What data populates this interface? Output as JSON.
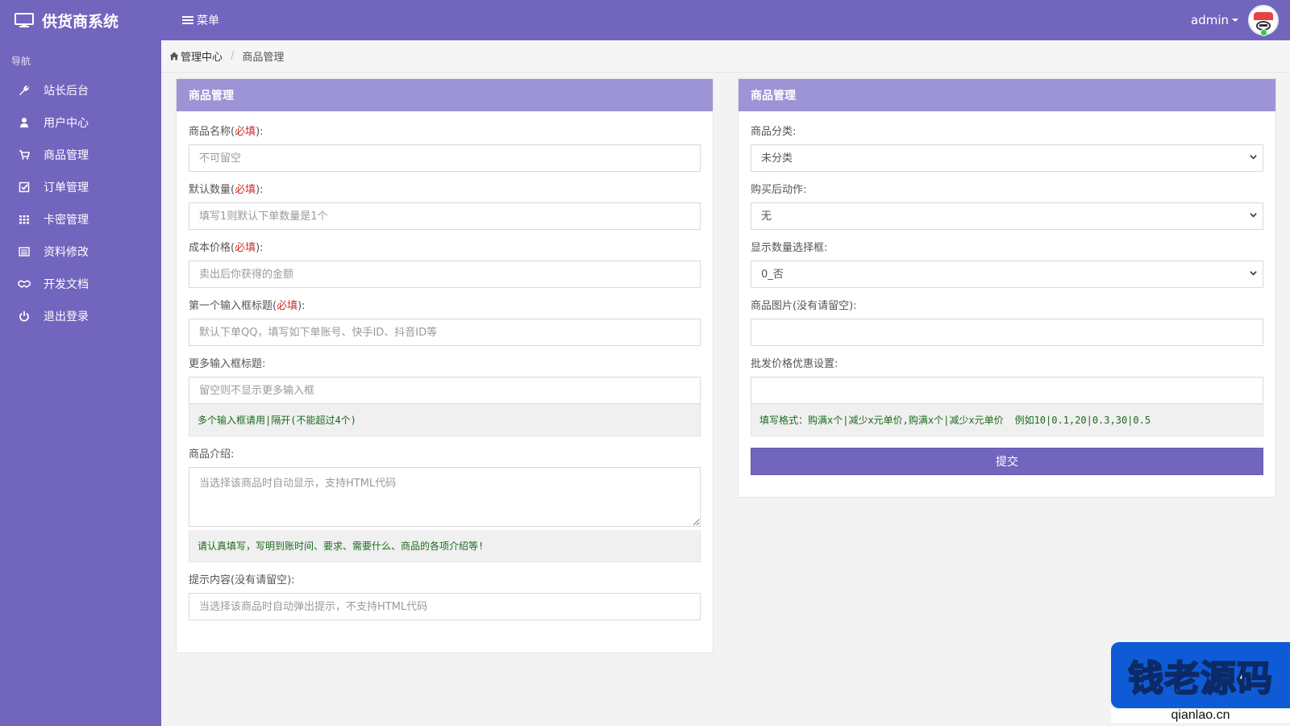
{
  "app": {
    "title": "供货商系统",
    "menu_label": "菜单"
  },
  "user": {
    "name": "admin"
  },
  "sidebar": {
    "heading": "导航",
    "items": [
      {
        "label": "站长后台",
        "icon": "wrench-icon"
      },
      {
        "label": "用户中心",
        "icon": "user-icon"
      },
      {
        "label": "商品管理",
        "icon": "cart-icon"
      },
      {
        "label": "订单管理",
        "icon": "check-square-icon"
      },
      {
        "label": "卡密管理",
        "icon": "grid-icon"
      },
      {
        "label": "资料修改",
        "icon": "list-icon"
      },
      {
        "label": "开发文档",
        "icon": "handshake-icon"
      },
      {
        "label": "退出登录",
        "icon": "power-icon"
      }
    ]
  },
  "breadcrumb": {
    "home": "管理中心",
    "current": "商品管理"
  },
  "left_panel": {
    "title": "商品管理",
    "required_mark": "必填",
    "fields": {
      "name": {
        "label": "商品名称",
        "placeholder": "不可留空",
        "value": ""
      },
      "qty": {
        "label": "默认数量",
        "placeholder": "填写1则默认下单数量是1个",
        "value": ""
      },
      "cost": {
        "label": "成本价格",
        "placeholder": "卖出后你获得的金额",
        "value": ""
      },
      "first_input": {
        "label": "第一个输入框标题",
        "placeholder": "默认下单QQ，填写如下单账号、快手ID、抖音ID等",
        "value": ""
      },
      "more_inputs": {
        "label": "更多输入框标题:",
        "placeholder": "留空则不显示更多输入框",
        "value": "",
        "help": "多个输入框请用|隔开(不能超过4个)"
      },
      "intro": {
        "label": "商品介绍:",
        "placeholder": "当选择该商品时自动显示，支持HTML代码",
        "value": "",
        "help": "请认真填写，写明到账时间、要求、需要什么、商品的各项介绍等!"
      },
      "tip": {
        "label": "提示内容(没有请留空):",
        "placeholder": "当选择该商品时自动弹出提示，不支持HTML代码",
        "value": ""
      }
    }
  },
  "right_panel": {
    "title": "商品管理",
    "fields": {
      "category": {
        "label": "商品分类:",
        "selected": "未分类"
      },
      "after_buy": {
        "label": "购买后动作:",
        "selected": "无"
      },
      "qty_select": {
        "label": "显示数量选择框:",
        "selected": "0_否"
      },
      "image": {
        "label": "商品图片(没有请留空):",
        "value": ""
      },
      "wholesale": {
        "label": "批发价格优惠设置:",
        "value": "",
        "help": "填写格式：购满x个|减少x元单价,购满x个|减少x元单价",
        "example": "例如10|0.1,20|0.3,30|0.5"
      }
    },
    "submit_label": "提交"
  },
  "watermark": {
    "text": "钱老源码",
    "url": "qianlao.cn"
  },
  "colors": {
    "primary": "#7165be",
    "panel_header": "#9d94d5",
    "required": "#c9302c",
    "help_text": "#1a6b1a"
  }
}
